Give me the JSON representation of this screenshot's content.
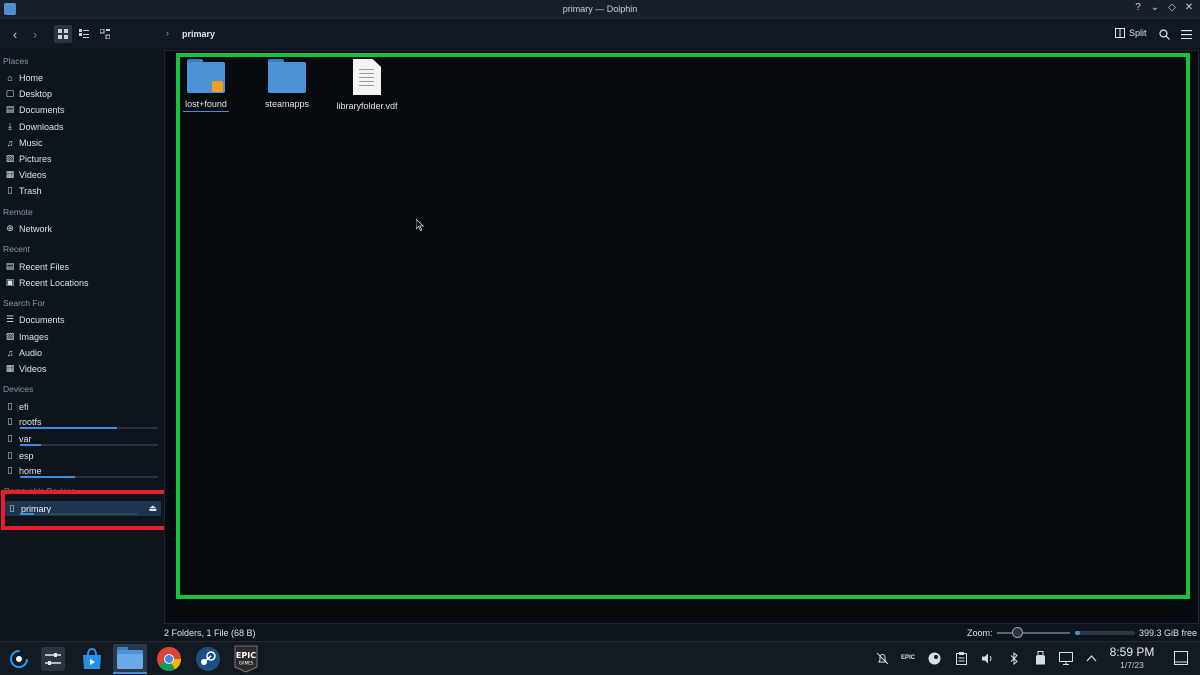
{
  "window": {
    "title": "primary — Dolphin",
    "controls": [
      "?",
      "⌄",
      "◇",
      "✕"
    ]
  },
  "toolbar": {
    "breadcrumb_label": "primary",
    "split_label": "Split"
  },
  "sidebar": {
    "sections": {
      "places": "Places",
      "remote": "Remote",
      "recent": "Recent",
      "search_for": "Search For",
      "devices": "Devices",
      "removable": "Removable Devices"
    },
    "places": [
      {
        "label": "Home",
        "icon": "home-icon"
      },
      {
        "label": "Desktop",
        "icon": "desktop-icon"
      },
      {
        "label": "Documents",
        "icon": "documents-icon"
      },
      {
        "label": "Downloads",
        "icon": "downloads-icon"
      },
      {
        "label": "Music",
        "icon": "music-icon"
      },
      {
        "label": "Pictures",
        "icon": "pictures-icon"
      },
      {
        "label": "Videos",
        "icon": "videos-icon"
      },
      {
        "label": "Trash",
        "icon": "trash-icon"
      }
    ],
    "remote": [
      {
        "label": "Network",
        "icon": "network-icon"
      }
    ],
    "recent": [
      {
        "label": "Recent Files",
        "icon": "recent-files-icon"
      },
      {
        "label": "Recent Locations",
        "icon": "recent-locations-icon"
      }
    ],
    "search_for": [
      {
        "label": "Documents",
        "icon": "documents-search-icon"
      },
      {
        "label": "Images",
        "icon": "images-icon"
      },
      {
        "label": "Audio",
        "icon": "audio-icon"
      },
      {
        "label": "Videos",
        "icon": "videos-search-icon"
      }
    ],
    "devices": [
      {
        "label": "efi",
        "icon": "drive-icon",
        "usage": null
      },
      {
        "label": "rootfs",
        "icon": "drive-icon",
        "usage": 0.7
      },
      {
        "label": "var",
        "icon": "drive-icon",
        "usage": 0.15
      },
      {
        "label": "esp",
        "icon": "drive-icon",
        "usage": null
      },
      {
        "label": "home",
        "icon": "drive-icon",
        "usage": 0.4
      }
    ],
    "removable": [
      {
        "label": "primary",
        "icon": "sd-card-icon",
        "usage": 0.12
      }
    ]
  },
  "files": [
    {
      "name": "lost+found",
      "type": "folder-locked"
    },
    {
      "name": "steamapps",
      "type": "folder"
    },
    {
      "name": "libraryfolder.vdf",
      "type": "file"
    }
  ],
  "statusbar": {
    "summary": "2 Folders, 1 File (68 B)",
    "zoom_label": "Zoom:",
    "free_space": "399.3 GiB free",
    "free_fraction": 0.08
  },
  "taskbar": {
    "apps": [
      {
        "name": "steamos-menu",
        "icon": "steamos-icon"
      },
      {
        "name": "system-settings",
        "icon": "settings-sliders-icon"
      },
      {
        "name": "discover",
        "icon": "store-icon"
      },
      {
        "name": "dolphin",
        "icon": "folder-app-icon"
      },
      {
        "name": "chrome",
        "icon": "chrome-icon"
      },
      {
        "name": "steam",
        "icon": "steam-icon"
      },
      {
        "name": "epic-games",
        "icon": "epic-games-icon",
        "logo_text": "EPIC GAMES"
      }
    ],
    "tray": [
      "notifications-muted-icon",
      "epic-tray-icon",
      "steam-tray-icon",
      "clipboard-icon",
      "volume-icon",
      "bluetooth-icon",
      "usb-device-icon",
      "display-icon",
      "chevron-up-icon"
    ],
    "time": "8:59 PM",
    "date": "1/7/23"
  },
  "colors": {
    "accent": "#3d8ee0",
    "highlight_red": "#e6202a",
    "highlight_green": "#19c23a"
  }
}
